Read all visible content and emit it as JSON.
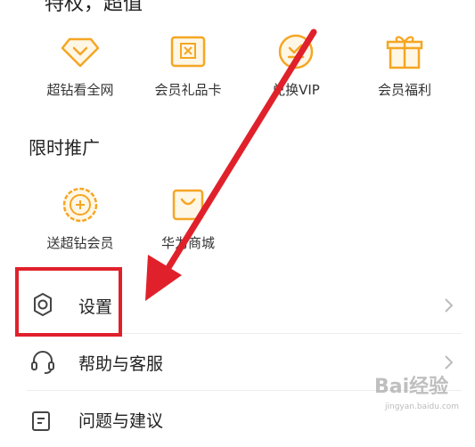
{
  "top_partial_text": "特权，超值",
  "benefits": [
    {
      "label": "超钻看全网",
      "icon": "diamond-heart-icon"
    },
    {
      "label": "会员礼品卡",
      "icon": "gift-card-icon"
    },
    {
      "label": "兑换VIP",
      "icon": "exchange-coin-icon"
    },
    {
      "label": "会员福利",
      "icon": "gift-box-icon"
    }
  ],
  "promo": {
    "title": "限时推广",
    "items": [
      {
        "label": "送超钻会员",
        "icon": "award-badge-icon"
      },
      {
        "label": "华为商城",
        "icon": "shopping-bag-icon"
      }
    ]
  },
  "menu": [
    {
      "label": "设置",
      "icon": "gear-icon"
    },
    {
      "label": "帮助与客服",
      "icon": "headset-icon"
    },
    {
      "label": "问题与建议",
      "icon": "edit-note-icon"
    }
  ],
  "colors": {
    "accent": "#f5a623",
    "annotation": "#e0212b"
  },
  "watermark": {
    "text": "Bai经验",
    "sub": "jingyan.baidu.com"
  }
}
